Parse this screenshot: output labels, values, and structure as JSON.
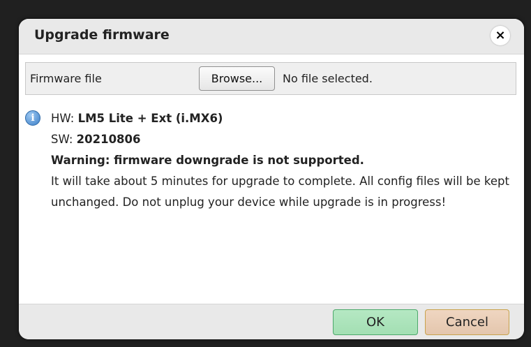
{
  "dialog": {
    "title": "Upgrade firmware",
    "close_symbol": "×",
    "close_icon": "close-icon"
  },
  "file": {
    "label": "Firmware file",
    "browse_label": "Browse...",
    "status": "No file selected."
  },
  "info": {
    "icon": "info-icon",
    "hw_label": "HW:",
    "hw_value": "LM5 Lite + Ext (i.MX6)",
    "sw_label": "SW:",
    "sw_value": "20210806",
    "warning": "Warning: firmware downgrade is not supported.",
    "description": "It will take about 5 minutes for upgrade to complete. All config files will be kept unchanged. Do not unplug your device while upgrade is in progress!"
  },
  "footer": {
    "ok_label": "OK",
    "cancel_label": "Cancel"
  },
  "colors": {
    "ok_bg": "#a3dfb3",
    "ok_border": "#4da86b",
    "cancel_bg": "#e4c6ad",
    "cancel_border": "#c8a24c",
    "info_icon": "#3d7fc7"
  }
}
